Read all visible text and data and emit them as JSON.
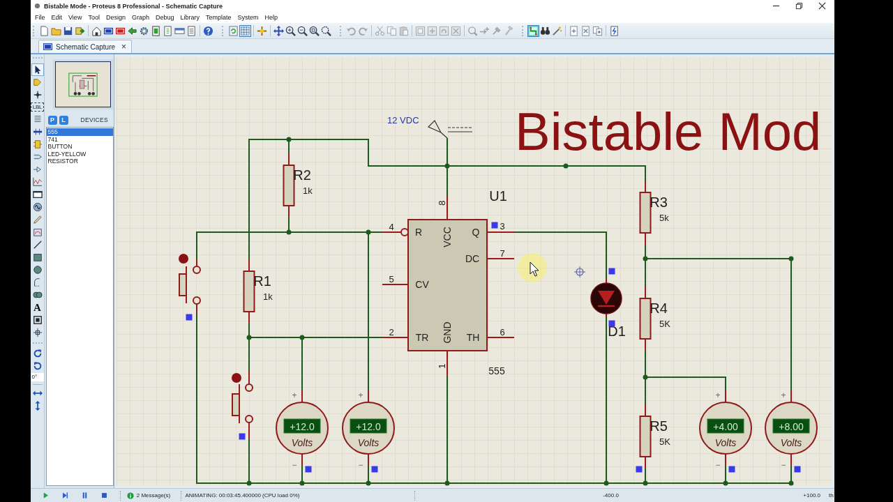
{
  "window": {
    "title": "Bistable Mode - Proteus 8 Professional - Schematic Capture"
  },
  "menu": [
    "File",
    "Edit",
    "View",
    "Tool",
    "Design",
    "Graph",
    "Debug",
    "Library",
    "Template",
    "System",
    "Help"
  ],
  "toolbar": {
    "grid_button": {
      "on": true
    },
    "edit_tools": {
      "disabled": true
    },
    "route_button": {
      "on": true
    }
  },
  "tabs": [
    {
      "label": "Schematic Capture",
      "close": "×",
      "selected": true
    }
  ],
  "left_toolbar": {
    "select_tool": {
      "on": true
    },
    "label_tool": "LBL",
    "text_tool": "A",
    "angle_field": {
      "value": "0°"
    }
  },
  "devices": {
    "mode_buttons": [
      {
        "label": "P"
      },
      {
        "label": "L"
      }
    ],
    "title": "DEVICES",
    "items": [
      {
        "label": "555",
        "selected": true
      },
      {
        "label": "741",
        "selected": false
      },
      {
        "label": "BUTTON",
        "selected": false
      },
      {
        "label": "LED-YELLOW",
        "selected": false
      },
      {
        "label": "RESISTOR",
        "selected": false
      }
    ]
  },
  "schematic": {
    "title": "Bistable Mod",
    "power": {
      "label": "12 VDC"
    },
    "chip": {
      "ref": "U1",
      "value": "555",
      "pins": [
        {
          "number": "4",
          "name": "R",
          "inverted": true
        },
        {
          "number": "8",
          "name": "VCC",
          "inverted": false
        },
        {
          "number": "3",
          "name": "Q",
          "inverted": false
        },
        {
          "number": "7",
          "name": "DC",
          "inverted": false
        },
        {
          "number": "5",
          "name": "CV",
          "inverted": false
        },
        {
          "number": "2",
          "name": "TR",
          "inverted": false
        },
        {
          "number": "1",
          "name": "GND",
          "inverted": false
        },
        {
          "number": "6",
          "name": "TH",
          "inverted": false
        }
      ]
    },
    "resistors": [
      {
        "ref": "R2",
        "value": "1k"
      },
      {
        "ref": "R1",
        "value": "1k"
      },
      {
        "ref": "R3",
        "value": "5k"
      },
      {
        "ref": "R4",
        "value": "5K"
      },
      {
        "ref": "R5",
        "value": "5K"
      }
    ],
    "led": {
      "ref": "D1"
    },
    "voltmeters": [
      {
        "reading": "+12.0",
        "unit": "Volts",
        "plus": "+",
        "minus": "−"
      },
      {
        "reading": "+12.0",
        "unit": "Volts",
        "plus": "+",
        "minus": "−"
      },
      {
        "reading": "+4.00",
        "unit": "Volts",
        "plus": "+",
        "minus": "−"
      },
      {
        "reading": "+8.00",
        "unit": "Volts",
        "plus": "+",
        "minus": "−"
      }
    ]
  },
  "status_bar": {
    "messages": "2 Message(s)",
    "state": "ANIMATING: 00:03:45.400000 (CPU load 0%)",
    "x_coord": "-400.0",
    "y_coord": "+100.0",
    "column_5": "th"
  }
}
